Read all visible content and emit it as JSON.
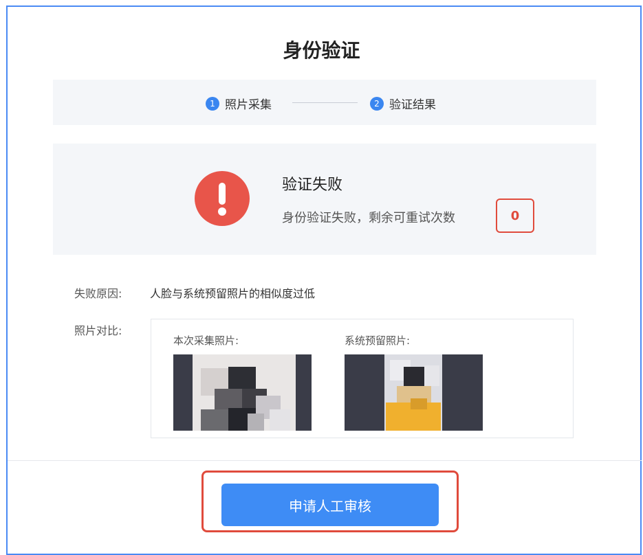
{
  "page": {
    "title": "身份验证"
  },
  "steps": [
    {
      "num": "1",
      "label": "照片采集"
    },
    {
      "num": "2",
      "label": "验证结果"
    }
  ],
  "result": {
    "title": "验证失败",
    "desc": "身份验证失败，剩余可重试次数",
    "retry_count": "0",
    "icon": "error-exclamation-icon",
    "icon_color": "#e8554a"
  },
  "failure": {
    "label": "失败原因:",
    "reason": "人脸与系统预留照片的相似度过低"
  },
  "compare": {
    "label": "照片对比:",
    "current_caption": "本次采集照片:",
    "reserved_caption": "系统预留照片:"
  },
  "action": {
    "button_label": "申请人工审核",
    "accent": "#3e8cf5",
    "highlight": "#e04b3c"
  }
}
